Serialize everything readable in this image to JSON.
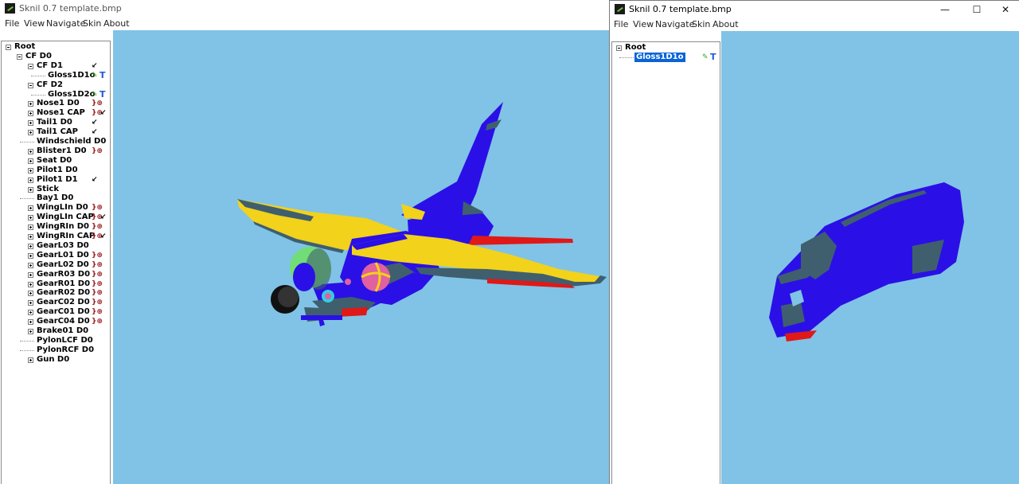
{
  "window1": {
    "title": "Sknil 0.7  template.bmp",
    "menu": [
      "File",
      "View",
      "Navigate",
      "Skin",
      "About"
    ],
    "tree": [
      {
        "label": "Root",
        "depth": 0,
        "expander": "minus"
      },
      {
        "label": "CF  D0",
        "depth": 1,
        "expander": "minus"
      },
      {
        "label": "CF  D1",
        "depth": 2,
        "expander": "minus",
        "icons": [
          "arrow-link-icon"
        ]
      },
      {
        "label": "Gloss1D1o",
        "depth": 3,
        "expander": "none",
        "icons": [
          "pencil-icon",
          "texture-t-icon"
        ]
      },
      {
        "label": "CF  D2",
        "depth": 2,
        "expander": "minus"
      },
      {
        "label": "Gloss1D2o",
        "depth": 3,
        "expander": "none",
        "icons": [
          "pencil-icon",
          "texture-t-icon"
        ]
      },
      {
        "label": "Nose1  D0",
        "depth": 2,
        "expander": "plus",
        "icons": [
          "lod-icon"
        ]
      },
      {
        "label": "Nose1  CAP",
        "depth": 2,
        "expander": "plus",
        "icons": [
          "lod-icon",
          "arrow-link-icon"
        ]
      },
      {
        "label": "Tail1  D0",
        "depth": 2,
        "expander": "plus",
        "icons": [
          "arrow-link-icon"
        ]
      },
      {
        "label": "Tail1  CAP",
        "depth": 2,
        "expander": "plus",
        "icons": [
          "arrow-link-icon"
        ]
      },
      {
        "label": "Windschield  D0",
        "depth": 2,
        "expander": "none"
      },
      {
        "label": "Blister1  D0",
        "depth": 2,
        "expander": "plus",
        "icons": [
          "lod-icon"
        ]
      },
      {
        "label": "Seat  D0",
        "depth": 2,
        "expander": "plus"
      },
      {
        "label": "Pilot1  D0",
        "depth": 2,
        "expander": "plus"
      },
      {
        "label": "Pilot1  D1",
        "depth": 2,
        "expander": "plus",
        "icons": [
          "arrow-link-icon"
        ]
      },
      {
        "label": "Stick",
        "depth": 2,
        "expander": "plus"
      },
      {
        "label": "Bay1  D0",
        "depth": 2,
        "expander": "none"
      },
      {
        "label": "WingLIn  D0",
        "depth": 2,
        "expander": "plus",
        "icons": [
          "lod-icon"
        ]
      },
      {
        "label": "WingLIn  CAP",
        "depth": 2,
        "expander": "plus",
        "icons": [
          "lod-icon",
          "arrow-link-icon"
        ]
      },
      {
        "label": "WingRIn  D0",
        "depth": 2,
        "expander": "plus",
        "icons": [
          "lod-icon"
        ]
      },
      {
        "label": "WingRIn  CAP",
        "depth": 2,
        "expander": "plus",
        "icons": [
          "lod-icon",
          "arrow-link-icon"
        ]
      },
      {
        "label": "GearL03  D0",
        "depth": 2,
        "expander": "plus"
      },
      {
        "label": "GearL01  D0",
        "depth": 2,
        "expander": "plus",
        "icons": [
          "lod-icon"
        ]
      },
      {
        "label": "GearL02  D0",
        "depth": 2,
        "expander": "plus",
        "icons": [
          "lod-icon"
        ]
      },
      {
        "label": "GearR03  D0",
        "depth": 2,
        "expander": "plus",
        "icons": [
          "lod-icon"
        ]
      },
      {
        "label": "GearR01  D0",
        "depth": 2,
        "expander": "plus",
        "icons": [
          "lod-icon"
        ]
      },
      {
        "label": "GearR02  D0",
        "depth": 2,
        "expander": "plus",
        "icons": [
          "lod-icon"
        ]
      },
      {
        "label": "GearC02  D0",
        "depth": 2,
        "expander": "plus",
        "icons": [
          "lod-icon"
        ]
      },
      {
        "label": "GearC01  D0",
        "depth": 2,
        "expander": "plus",
        "icons": [
          "lod-icon"
        ]
      },
      {
        "label": "GearC04  D0",
        "depth": 2,
        "expander": "plus",
        "icons": [
          "lod-icon"
        ]
      },
      {
        "label": "Brake01  D0",
        "depth": 2,
        "expander": "plus"
      },
      {
        "label": "PylonLCF  D0",
        "depth": 2,
        "expander": "none"
      },
      {
        "label": "PylonRCF  D0",
        "depth": 2,
        "expander": "none"
      },
      {
        "label": "Gun  D0",
        "depth": 2,
        "expander": "plus"
      }
    ]
  },
  "window2": {
    "title": "Sknil 0.7  template.bmp",
    "menu": [
      "File",
      "View",
      "Navigate",
      "Skin",
      "About"
    ],
    "controls": {
      "minimize": "—",
      "maximize": "☐",
      "close": "✕"
    },
    "tree": [
      {
        "label": "Root",
        "depth": 0,
        "expander": "minus"
      },
      {
        "label": "Gloss1D1o",
        "depth": 1,
        "expander": "none",
        "selected": true,
        "icons": [
          "pencil-icon",
          "texture-t-icon"
        ]
      }
    ]
  },
  "colors": {
    "viewport_bg": "#80c3e6",
    "fuselage_blue": "#2a10e6",
    "wing_yellow": "#f2d21a",
    "trim_red": "#e01818",
    "shadow_gray": "#3f5f6e",
    "selection_blue": "#0a64d6"
  }
}
